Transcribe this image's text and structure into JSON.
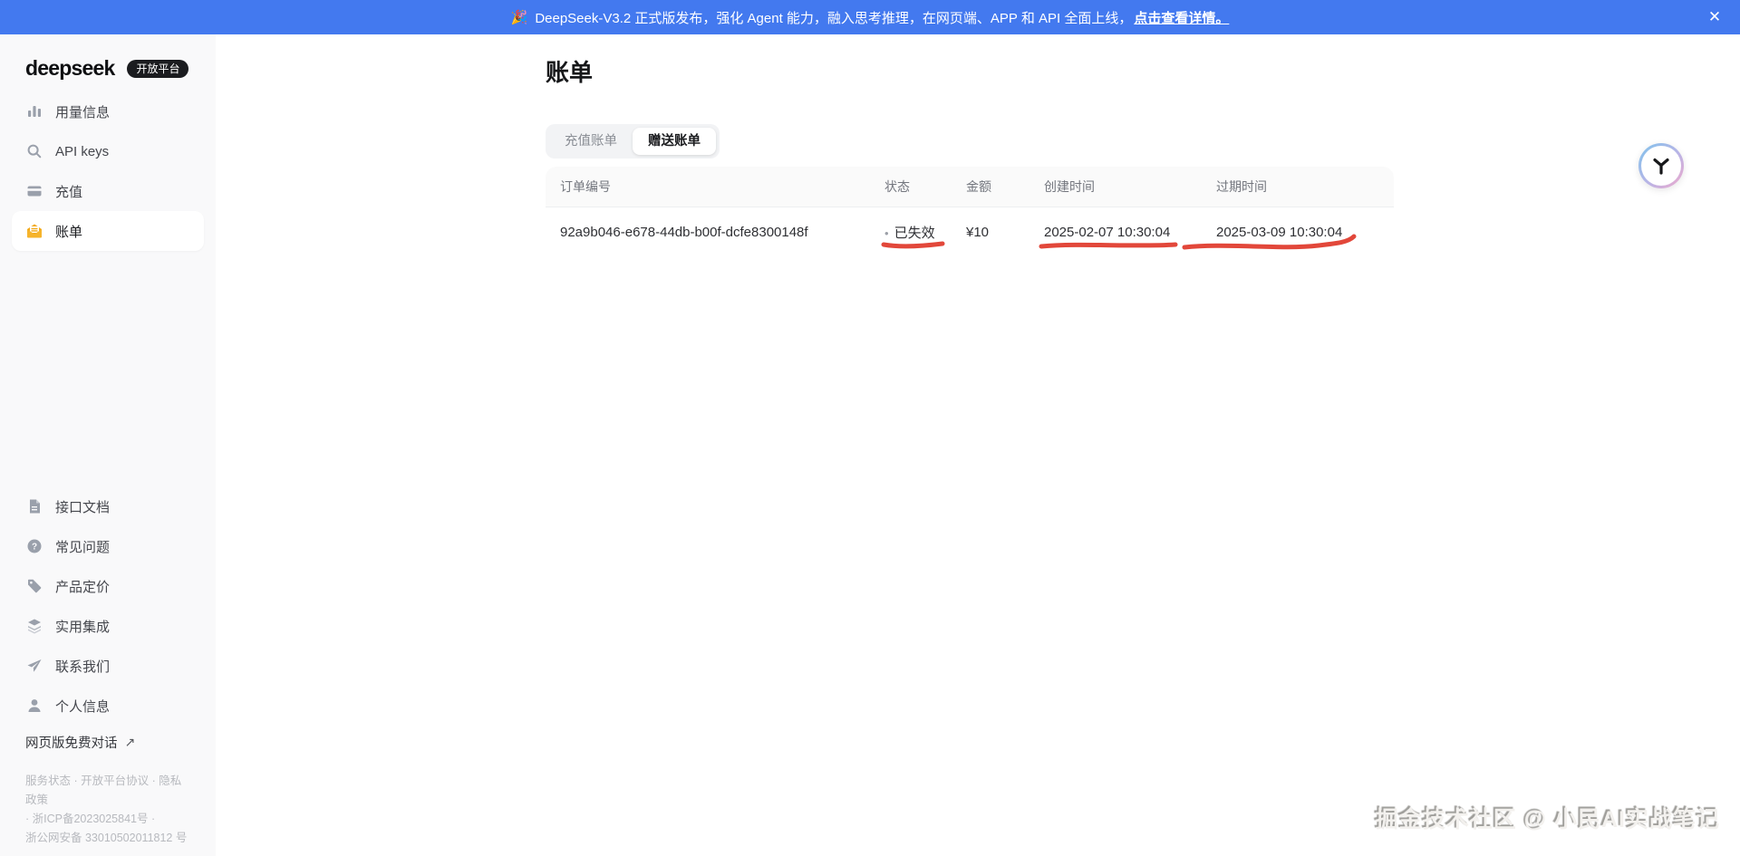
{
  "banner": {
    "emoji": "🎉",
    "text": "DeepSeek-V3.2 正式版发布，强化 Agent 能力，融入思考推理，在网页端、APP 和 API 全面上线，",
    "link": "点击查看详情。",
    "close_icon": "✕",
    "bg_color": "#4379ef"
  },
  "sidebar": {
    "logo_text": "deepseek",
    "badge": "开放平台",
    "nav_top": [
      {
        "label": "用量信息",
        "icon": "usage-chart-icon"
      },
      {
        "label": "API keys",
        "icon": "api-keys-icon"
      },
      {
        "label": "充值",
        "icon": "recharge-card-icon"
      },
      {
        "label": "账单",
        "icon": "billing-envelope-icon",
        "active": true
      }
    ],
    "nav_bottom": [
      {
        "label": "接口文档",
        "icon": "docs-icon"
      },
      {
        "label": "常见问题",
        "icon": "faq-icon"
      },
      {
        "label": "产品定价",
        "icon": "pricing-tag-icon"
      },
      {
        "label": "实用集成",
        "icon": "integrations-icon"
      },
      {
        "label": "联系我们",
        "icon": "contact-icon"
      },
      {
        "label": "个人信息",
        "icon": "profile-icon"
      }
    ],
    "web_chat_link": "网页版免费对话",
    "web_chat_arrow": "↗",
    "footer_lines": {
      "line1": "服务状态 · 开放平台协议 · 隐私政策",
      "line2": "· 浙ICP备2023025841号 ·",
      "line3": "浙公网安备 33010502011812 号"
    }
  },
  "main": {
    "title": "账单",
    "tabs": [
      {
        "label": "充值账单",
        "active": false
      },
      {
        "label": "赠送账单",
        "active": true
      }
    ],
    "table": {
      "columns": [
        "订单编号",
        "状态",
        "金额",
        "创建时间",
        "过期时间"
      ],
      "status_bullet": "•",
      "rows": [
        {
          "order_id": "92a9b046-e678-44db-b00f-dcfe8300148f",
          "status": "已失效",
          "amount": "¥10",
          "created_at": "2025-02-07 10:30:04",
          "expires_at": "2025-03-09 10:30:04"
        }
      ]
    }
  },
  "annotations": {
    "underline_color": "#e2473a",
    "underlined_items": [
      "已失效",
      "2025-02-07 10:30:04",
      "2025-03-09 10:30:04"
    ]
  },
  "watermark": "掘金技术社区 @ 小民AI实战笔记",
  "colors": {
    "banner_bg": "#4379ef",
    "sidebar_bg": "#f9f9fa",
    "active_icon_amber": "#f2a818",
    "annotation_red": "#e2473a",
    "widget_gradient": [
      "#7fc3ec",
      "#f0a9cb"
    ]
  }
}
